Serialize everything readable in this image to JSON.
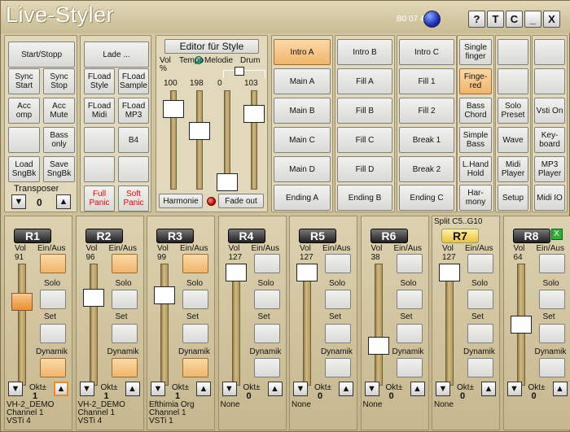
{
  "app": {
    "title": "Live-Styler",
    "code": "B0 07 40",
    "buttons": [
      {
        "name": "help-button",
        "label": "?"
      },
      {
        "name": "t-button",
        "label": "T"
      },
      {
        "name": "c-button",
        "label": "C"
      },
      {
        "name": "minimize-button",
        "label": "_"
      },
      {
        "name": "close-button",
        "label": "X"
      }
    ]
  },
  "control": {
    "rows": [
      [
        {
          "label": "Start/Stopp",
          "span": 2
        }
      ],
      [
        {
          "label": "Sync Start"
        },
        {
          "label": "Sync Stop"
        }
      ],
      [
        {
          "label": "Acc omp"
        },
        {
          "label": "Acc Mute"
        }
      ],
      [
        {
          "label": ""
        },
        {
          "label": "Bass only"
        }
      ],
      [
        {
          "label": "Load SngBk"
        },
        {
          "label": "Save SngBk"
        }
      ]
    ],
    "transposer_label": "Transposer",
    "transposer_value": "0"
  },
  "files": {
    "rows": [
      [
        {
          "label": "Lade ...",
          "span": 2
        }
      ],
      [
        {
          "label": "FLoad Style"
        },
        {
          "label": "FLoad Sample"
        }
      ],
      [
        {
          "label": "FLoad Midi"
        },
        {
          "label": "FLoad MP3"
        }
      ],
      [
        {
          "label": ""
        },
        {
          "label": "B4"
        }
      ],
      [
        {
          "label": ""
        },
        {
          "label": ""
        }
      ],
      [
        {
          "label": "Full Panic",
          "red": true
        },
        {
          "label": "Soft Panic",
          "red": true
        }
      ]
    ]
  },
  "editor": {
    "title": "Editor für Style",
    "sliders": [
      {
        "label": "Vol %",
        "value": "100",
        "level": 0.88
      },
      {
        "label": "Tempo",
        "value": "198",
        "level": 0.62
      },
      {
        "label": "Melodie",
        "value": "0",
        "level": 0.0
      },
      {
        "label": "Drum",
        "value": "103",
        "level": 0.82
      }
    ],
    "harmonie": "Harmonie",
    "fadeout": "Fade out"
  },
  "grid": [
    [
      {
        "label": "Intro A",
        "on": true
      },
      {
        "label": "Intro B"
      },
      {
        "label": "Intro C"
      },
      {
        "label": "Single finger"
      },
      {
        "label": ""
      },
      {
        "label": ""
      }
    ],
    [
      {
        "label": "Main A"
      },
      {
        "label": "Fill A"
      },
      {
        "label": "Fill 1"
      },
      {
        "label": "Finge- red",
        "on": true
      },
      {
        "label": ""
      },
      {
        "label": ""
      }
    ],
    [
      {
        "label": "Main B"
      },
      {
        "label": "Fill B"
      },
      {
        "label": "Fill 2"
      },
      {
        "label": "Bass Chord"
      },
      {
        "label": "Solo Preset"
      },
      {
        "label": "Vsti On"
      }
    ],
    [
      {
        "label": "Main C"
      },
      {
        "label": "Fill C"
      },
      {
        "label": "Break 1"
      },
      {
        "label": "Simple Bass"
      },
      {
        "label": "Wave"
      },
      {
        "label": "Key- board"
      }
    ],
    [
      {
        "label": "Main D"
      },
      {
        "label": "Fill D"
      },
      {
        "label": "Break 2"
      },
      {
        "label": "L.Hand Hold"
      },
      {
        "label": "Midi Player"
      },
      {
        "label": "MP3 Player"
      }
    ],
    [
      {
        "label": "Ending A"
      },
      {
        "label": "Ending B"
      },
      {
        "label": "Ending C"
      },
      {
        "label": "Har- mony"
      },
      {
        "label": "Setup"
      },
      {
        "label": "Midi IO"
      }
    ]
  ],
  "channel_labels": {
    "vol": "Vol",
    "einaus": "Ein/Aus",
    "solo": "Solo",
    "set": "Set",
    "dynamik": "Dynamik",
    "okt": "Okt±"
  },
  "split_label": "Split C5..G10",
  "channels": [
    {
      "name": "R1",
      "vol": "91",
      "level": 0.72,
      "okt": "1",
      "dev": [
        "VH-2_DEMO",
        "Channel 1",
        "VSTi 4"
      ],
      "on": [
        true,
        false,
        false,
        true
      ],
      "thumb_on": true,
      "up_on": true
    },
    {
      "name": "R2",
      "vol": "96",
      "level": 0.76,
      "okt": "1",
      "dev": [
        "VH-2_DEMO",
        "Channel 1",
        "VSTi 4"
      ],
      "on": [
        true,
        false,
        false,
        true
      ]
    },
    {
      "name": "R3",
      "vol": "99",
      "level": 0.78,
      "okt": "1",
      "dev": [
        "Efthimia Org",
        "Channel 1",
        "VSTi 1"
      ],
      "on": [
        true,
        false,
        false,
        true
      ]
    },
    {
      "name": "R4",
      "vol": "127",
      "level": 1.0,
      "okt": "0",
      "dev": [
        "None"
      ],
      "on": [
        false,
        false,
        false,
        false
      ]
    },
    {
      "name": "R5",
      "vol": "127",
      "level": 1.0,
      "okt": "0",
      "dev": [
        "None"
      ],
      "on": [
        false,
        false,
        false,
        false
      ]
    },
    {
      "name": "R6",
      "vol": "38",
      "level": 0.3,
      "okt": "0",
      "dev": [
        "None"
      ],
      "on": [
        false,
        false,
        false,
        false
      ]
    },
    {
      "name": "R7",
      "vol": "127",
      "level": 1.0,
      "okt": "0",
      "dev": [
        "None"
      ],
      "on": [
        false,
        false,
        false,
        false
      ],
      "gold": true
    },
    {
      "name": "R8",
      "vol": "64",
      "level": 0.5,
      "okt": "0",
      "dev": [],
      "on": [
        false,
        false,
        false,
        false
      ],
      "badge": "X"
    }
  ]
}
